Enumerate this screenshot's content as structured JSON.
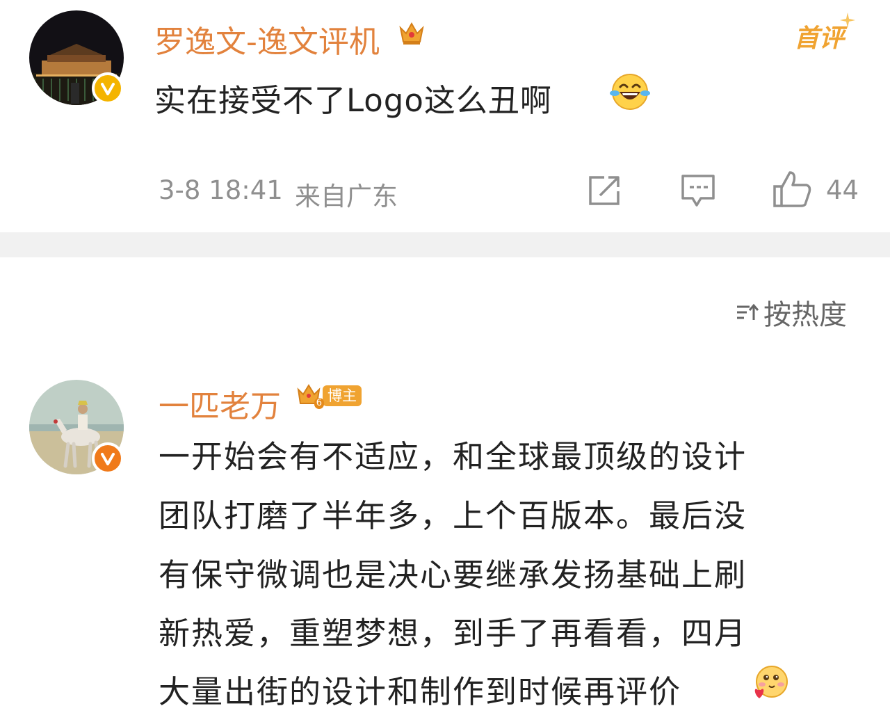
{
  "top_comment": {
    "username": "罗逸文-逸文评机",
    "badge_label": "首评",
    "text": "实在接受不了Logo这么丑啊",
    "timestamp": "3-8 18:41",
    "location": "来自广东",
    "like_count": "44",
    "icons": [
      "crown-icon",
      "laugh-cry-emoji-icon",
      "share-icon",
      "comment-icon",
      "like-icon",
      "verified-v-icon"
    ]
  },
  "sort": {
    "label": "按热度",
    "icon": "sort-icon"
  },
  "reply": {
    "username": "一匹老万",
    "role_badge": "博主",
    "badge_level": "6",
    "lines": [
      "一开始会有不适应，和全球最顶级的设计",
      "团队打磨了半年多，上个百版本。最后没",
      "有保守微调也是决心要继承发扬基础上刷",
      "新热爱，重塑梦想，到手了再看看，四月",
      "大量出街的设计和制作到时候再评价"
    ],
    "icons": [
      "blush-heart-emoji-icon",
      "verified-v-icon"
    ]
  },
  "colors": {
    "username": "#e2823d",
    "badge_orange": "#f0a331",
    "text": "#222222",
    "meta": "#8f8f8f",
    "divider": "#f1f1f1",
    "sort_label": "#666666"
  }
}
